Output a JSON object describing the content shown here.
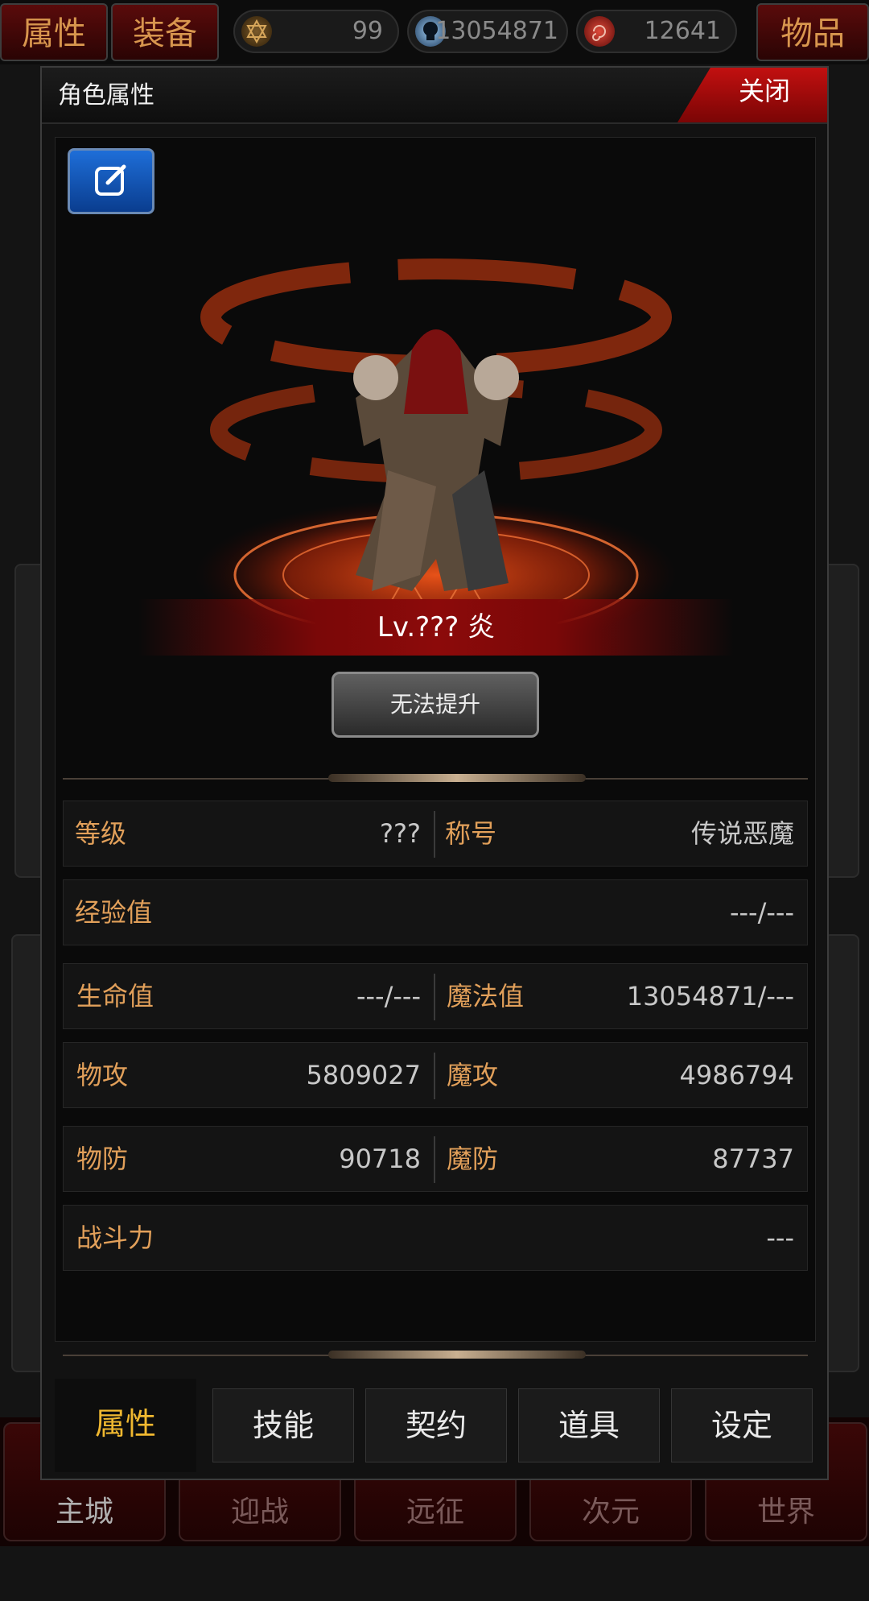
{
  "topbar": {
    "attributes_label": "属性",
    "equipment_label": "装备",
    "items_label": "物品",
    "resources": [
      {
        "icon": "hexagram-icon",
        "value": "99"
      },
      {
        "icon": "skull-icon",
        "value": "13054871"
      },
      {
        "icon": "swirl-icon",
        "value": "12641"
      }
    ]
  },
  "bottom_nav": {
    "items": [
      "主城",
      "迎战",
      "远征",
      "次元",
      "世界"
    ]
  },
  "dialog": {
    "title": "角色属性",
    "close_label": "关闭",
    "level_text": "Lv.??? 炎",
    "upgrade_label": "无法提升"
  },
  "stats": {
    "level": {
      "label": "等级",
      "value": "???"
    },
    "title": {
      "label": "称号",
      "value": "传说恶魔"
    },
    "exp": {
      "label": "经验值",
      "value": "---/---"
    },
    "hp": {
      "label": "生命值",
      "value": "---/---"
    },
    "mp": {
      "label": "魔法值",
      "value": "13054871/---"
    },
    "patk": {
      "label": "物攻",
      "value": "5809027"
    },
    "matk": {
      "label": "魔攻",
      "value": "4986794"
    },
    "pdef": {
      "label": "物防",
      "value": "90718"
    },
    "mdef": {
      "label": "魔防",
      "value": "87737"
    },
    "power": {
      "label": "战斗力",
      "value": "---"
    }
  },
  "tabs": [
    {
      "label": "属性",
      "active": true
    },
    {
      "label": "技能",
      "active": false
    },
    {
      "label": "契约",
      "active": false
    },
    {
      "label": "道具",
      "active": false
    },
    {
      "label": "设定",
      "active": false
    }
  ],
  "colors": {
    "accent_red": "#c21010",
    "label_orange": "#e2a05a",
    "active_tab_gold": "#f0b830"
  }
}
